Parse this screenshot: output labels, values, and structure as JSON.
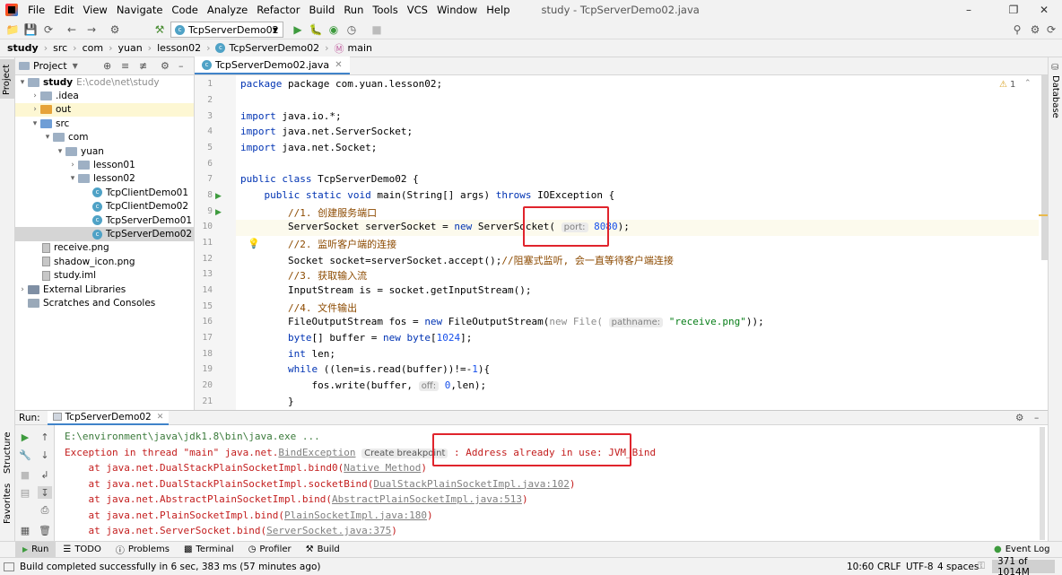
{
  "menu": {
    "items": [
      "File",
      "Edit",
      "View",
      "Navigate",
      "Code",
      "Analyze",
      "Refactor",
      "Build",
      "Run",
      "Tools",
      "VCS",
      "Window",
      "Help"
    ],
    "window_title": "study - TcpServerDemo02.java"
  },
  "toolbar": {
    "run_config": "TcpServerDemo02"
  },
  "breadcrumbs": [
    "study",
    "src",
    "com",
    "yuan",
    "lesson02",
    "TcpServerDemo02",
    "main"
  ],
  "project_panel": {
    "title": "Project",
    "tree": [
      {
        "label": "study",
        "extra": "E:\\code\\net\\study",
        "kind": "root"
      },
      {
        "label": ".idea",
        "kind": "folder"
      },
      {
        "label": "out",
        "kind": "folder-orange"
      },
      {
        "label": "src",
        "kind": "folder-blue"
      },
      {
        "label": "com",
        "kind": "folder"
      },
      {
        "label": "yuan",
        "kind": "folder"
      },
      {
        "label": "lesson01",
        "kind": "folder"
      },
      {
        "label": "lesson02",
        "kind": "folder"
      },
      {
        "label": "TcpClientDemo01",
        "kind": "class"
      },
      {
        "label": "TcpClientDemo02",
        "kind": "class"
      },
      {
        "label": "TcpServerDemo01",
        "kind": "class"
      },
      {
        "label": "TcpServerDemo02",
        "kind": "class",
        "selected": true
      },
      {
        "label": "receive.png",
        "kind": "file"
      },
      {
        "label": "shadow_icon.png",
        "kind": "file"
      },
      {
        "label": "study.iml",
        "kind": "file"
      },
      {
        "label": "External Libraries",
        "kind": "lib"
      },
      {
        "label": "Scratches and Consoles",
        "kind": "scratch"
      }
    ]
  },
  "editor": {
    "tab": "TcpServerDemo02.java",
    "warnings": "1",
    "line_numbers": [
      "1",
      "2",
      "3",
      "4",
      "5",
      "6",
      "7",
      "8",
      "9",
      "10",
      "11",
      "12",
      "13",
      "14",
      "15",
      "16",
      "17",
      "18",
      "19",
      "20",
      "21"
    ],
    "code": {
      "l1": "package com.yuan.lesson02;",
      "l3a": "import",
      "l3b": " java.io.*;",
      "l4a": "import",
      "l4b": " java.net.ServerSocket;",
      "l5a": "import",
      "l5b": " java.net.Socket;",
      "l7a": "public class",
      "l7b": " TcpServerDemo02 {",
      "l8a": "    public static void",
      "l8b": " main(String[] args) ",
      "l8c": "throws",
      "l8d": " IOException {",
      "l9": "        //1. 创建服务端口",
      "l10a": "        ServerSocket serverSocket = ",
      "l10b": "new",
      "l10c": " ServerSocket(",
      "l10hint": "port:",
      "l10num": "8080",
      "l10d": ");",
      "l11": "        //2. 监听客户端的连接",
      "l12a": "        Socket socket=serverSocket.accept();",
      "l12b": "//阻塞式监听, 会一直等待客户端连接",
      "l13": "        //3. 获取输入流",
      "l14": "        InputStream is = socket.getInputStream();",
      "l15": "        //4. 文件输出",
      "l16a": "        FileOutputStream fos = ",
      "l16b": "new",
      "l16c": " FileOutputStream(",
      "l16d": "new File(",
      "l16hint": "pathname:",
      "l16str": "\"receive.png\"",
      "l16e": "));",
      "l17a": "        ",
      "l17b": "byte",
      "l17c": "[] buffer = ",
      "l17d": "new",
      "l17e": " byte",
      "l17f": "[",
      "l17num": "1024",
      "l17g": "];",
      "l18a": "        ",
      "l18b": "int",
      "l18c": " len;",
      "l19a": "        ",
      "l19b": "while",
      "l19c": " ((len=is.read(buffer))!=-",
      "l19num": "1",
      "l19d": "){",
      "l20a": "            fos.write(buffer, ",
      "l20hint": "off:",
      "l20num": "0",
      "l20b": ",len);",
      "l21": "        }"
    }
  },
  "run_panel": {
    "title": "Run:",
    "tab": "TcpServerDemo02",
    "lines": {
      "cmd": "E:\\environment\\java\\jdk1.8\\bin\\java.exe ...",
      "exc_a": "Exception in thread \"main\" java.net.",
      "exc_link": "BindException",
      "exc_hint": "Create breakpoint",
      "exc_colon": " : ",
      "exc_msg": "Address already in use: JVM_Bind",
      "t1a": "    at java.net.DualStackPlainSocketImpl.bind0(",
      "t1l": "Native Method",
      "t1b": ")",
      "t2a": "    at java.net.DualStackPlainSocketImpl.socketBind(",
      "t2l": "DualStackPlainSocketImpl.java:102",
      "t2b": ")",
      "t3a": "    at java.net.AbstractPlainSocketImpl.bind(",
      "t3l": "AbstractPlainSocketImpl.java:513",
      "t3b": ")",
      "t4a": "    at java.net.PlainSocketImpl.bind(",
      "t4l": "PlainSocketImpl.java:180",
      "t4b": ")",
      "t5a": "    at java.net.ServerSocket.bind(",
      "t5l": "ServerSocket.java:375",
      "t5b": ")"
    }
  },
  "bottom_tabs": [
    "Run",
    "TODO",
    "Problems",
    "Terminal",
    "Profiler",
    "Build"
  ],
  "event_log": "Event Log",
  "side_labels": {
    "project": "Project",
    "structure": "Structure",
    "favorites": "Favorites",
    "database": "Database"
  },
  "status": {
    "message": "Build completed successfully in 6 sec, 383 ms (57 minutes ago)",
    "position": "10:60",
    "line_sep": "CRLF",
    "encoding": "UTF-8",
    "indent": "4 spaces",
    "memory": "371 of 1014M"
  },
  "colors": {
    "accent": "#4083c9",
    "error": "#c31d1d",
    "highlight_box": "#e0242c"
  }
}
